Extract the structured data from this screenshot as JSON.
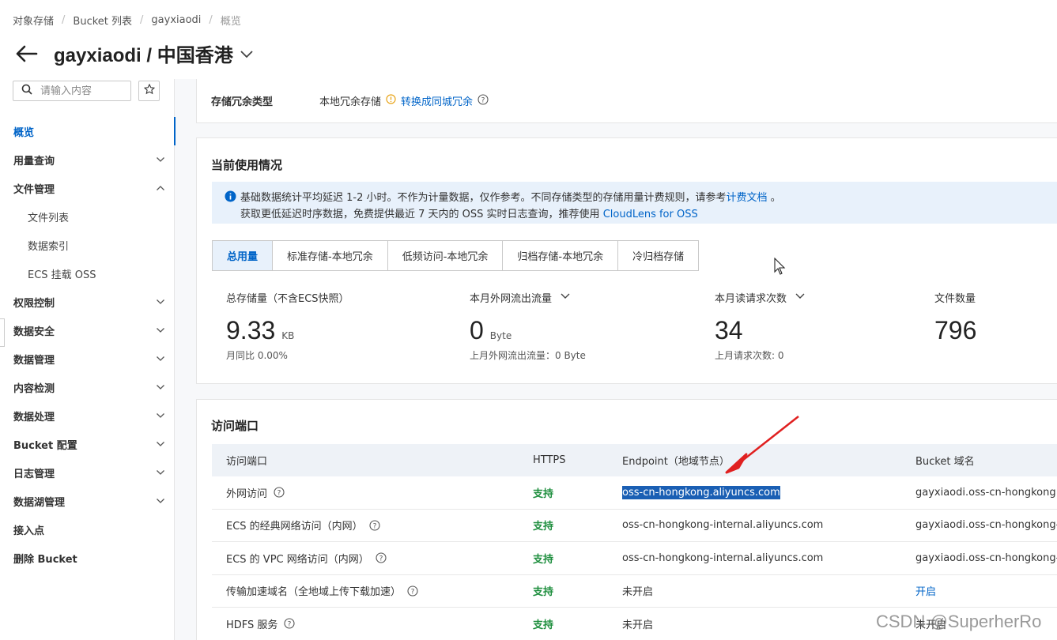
{
  "breadcrumb": [
    "对象存储",
    "Bucket 列表",
    "gayxiaodi",
    "概览"
  ],
  "header": {
    "title": "gayxiaodi / 中国香港"
  },
  "sidebar": {
    "search_placeholder": "请输入内容",
    "items": [
      {
        "label": "概览",
        "active": true,
        "expand": ""
      },
      {
        "label": "用量查询",
        "expand": "down"
      },
      {
        "label": "文件管理",
        "expand": "up"
      },
      {
        "label": "文件列表",
        "sub": true
      },
      {
        "label": "数据索引",
        "sub": true
      },
      {
        "label": "ECS 挂载 OSS",
        "sub": true
      },
      {
        "label": "权限控制",
        "expand": "down"
      },
      {
        "label": "数据安全",
        "expand": "down"
      },
      {
        "label": "数据管理",
        "expand": "down"
      },
      {
        "label": "内容检测",
        "expand": "down"
      },
      {
        "label": "数据处理",
        "expand": "down"
      },
      {
        "label": "Bucket 配置",
        "expand": "down"
      },
      {
        "label": "日志管理",
        "expand": "down"
      },
      {
        "label": "数据湖管理",
        "expand": "down"
      },
      {
        "label": "接入点"
      },
      {
        "label": "删除 Bucket"
      }
    ]
  },
  "redundancy": {
    "label": "存储冗余类型",
    "value": "本地冗余存储",
    "link": "转换成同城冗余"
  },
  "usage": {
    "title": "当前使用情况",
    "notice_line1": "基础数据统计平均延迟 1-2 小时。不作为计量数据，仅作参考。不同存储类型的存储用量计费规则，请参考",
    "notice_link1": "计费文档",
    "notice_tail1": " 。",
    "notice_line2": "获取更低延迟时序数据，免费提供最近 7 天内的 OSS 实时日志查询，推荐使用",
    "notice_link2": "CloudLens for OSS",
    "tabs": [
      "总用量",
      "标准存储-本地冗余",
      "低频访问-本地冗余",
      "归档存储-本地冗余",
      "冷归档存储"
    ],
    "stats": {
      "storage": {
        "label": "总存储量（不含ECS快照）",
        "value": "9.33",
        "unit": "KB",
        "sub": "月同比  0.00%"
      },
      "outbound": {
        "label": "本月外网流出流量",
        "value": "0",
        "unit": "Byte",
        "sub": "上月外网流出流量：0 Byte"
      },
      "reads": {
        "label": "本月读请求次数",
        "value": "34",
        "unit": "",
        "sub": "上月请求次数:    0"
      },
      "files": {
        "label": "文件数量",
        "value": "796",
        "unit": "",
        "sub": ""
      }
    }
  },
  "endpoints": {
    "title": "访问端口",
    "columns": [
      "访问端口",
      "HTTPS",
      "Endpoint（地域节点）",
      "Bucket 域名"
    ],
    "rows": [
      {
        "name": "外网访问",
        "https": "支持",
        "endpoint": "oss-cn-hongkong.aliyuncs.com",
        "domain": "gayxiaodi.oss-cn-hongkong.ali"
      },
      {
        "name": "ECS 的经典网络访问（内网）",
        "https": "支持",
        "endpoint": "oss-cn-hongkong-internal.aliyuncs.com",
        "domain": "gayxiaodi.oss-cn-hongkong-in"
      },
      {
        "name": "ECS 的 VPC 网络访问（内网）",
        "https": "支持",
        "endpoint": "oss-cn-hongkong-internal.aliyuncs.com",
        "domain": "gayxiaodi.oss-cn-hongkong-in"
      },
      {
        "name": "传输加速域名（全地域上传下载加速）",
        "https": "支持",
        "endpoint": "未开启",
        "domain": "开启"
      },
      {
        "name": "HDFS 服务",
        "https": "支持",
        "endpoint": "未开启",
        "domain": "未开启"
      }
    ]
  },
  "watermark": "CSDN @SuperherRo",
  "colors": {
    "accent": "#0064c8",
    "success": "#1e8e3e",
    "highlight": "#1a5fb4",
    "annotation_arrow": "#e02020"
  }
}
